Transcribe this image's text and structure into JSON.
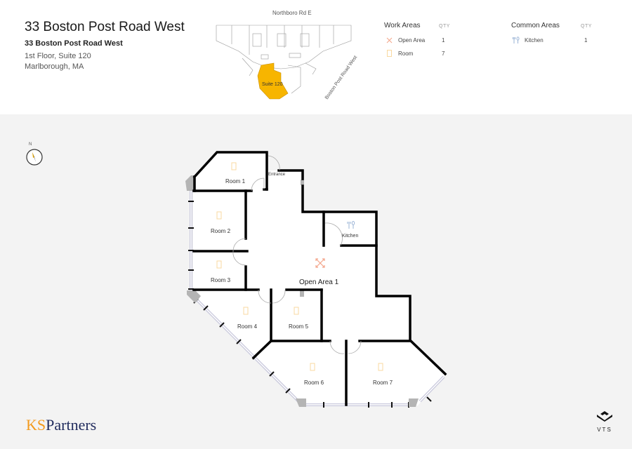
{
  "header": {
    "title": "33 Boston Post Road West",
    "address_line1": "33 Boston Post Road West",
    "address_line2": "1st Floor, Suite 120",
    "address_line3": "Marlborough, MA"
  },
  "keymap": {
    "street_top": "Northboro Rd E",
    "street_right": "Boston Post Road West",
    "suite_label": "Suite 120",
    "highlight_color": "#f7b500"
  },
  "legend": {
    "work_areas": {
      "heading": "Work Areas",
      "qty_heading": "QTY",
      "items": [
        {
          "icon": "open-area-icon",
          "label": "Open Area",
          "qty": "1",
          "color": "#f4a58a"
        },
        {
          "icon": "room-icon",
          "label": "Room",
          "qty": "7",
          "color": "#f9d9a0"
        }
      ]
    },
    "common_areas": {
      "heading": "Common Areas",
      "qty_heading": "QTY",
      "items": [
        {
          "icon": "kitchen-icon",
          "label": "Kitchen",
          "qty": "1",
          "color": "#9ab3d6"
        }
      ]
    }
  },
  "compass": {
    "label": "N"
  },
  "floorplan": {
    "rooms": [
      {
        "id": "room-1",
        "label": "Room 1"
      },
      {
        "id": "room-2",
        "label": "Room 2"
      },
      {
        "id": "room-3",
        "label": "Room 3"
      },
      {
        "id": "room-4",
        "label": "Room 4"
      },
      {
        "id": "room-5",
        "label": "Room 5"
      },
      {
        "id": "room-6",
        "label": "Room 6"
      },
      {
        "id": "room-7",
        "label": "Room 7"
      }
    ],
    "open_area": "Open Area 1",
    "kitchen": "Kitchen",
    "entrance": "Entrance"
  },
  "branding": {
    "ks": "KS",
    "partners": "Partners",
    "vts": "VTS"
  }
}
